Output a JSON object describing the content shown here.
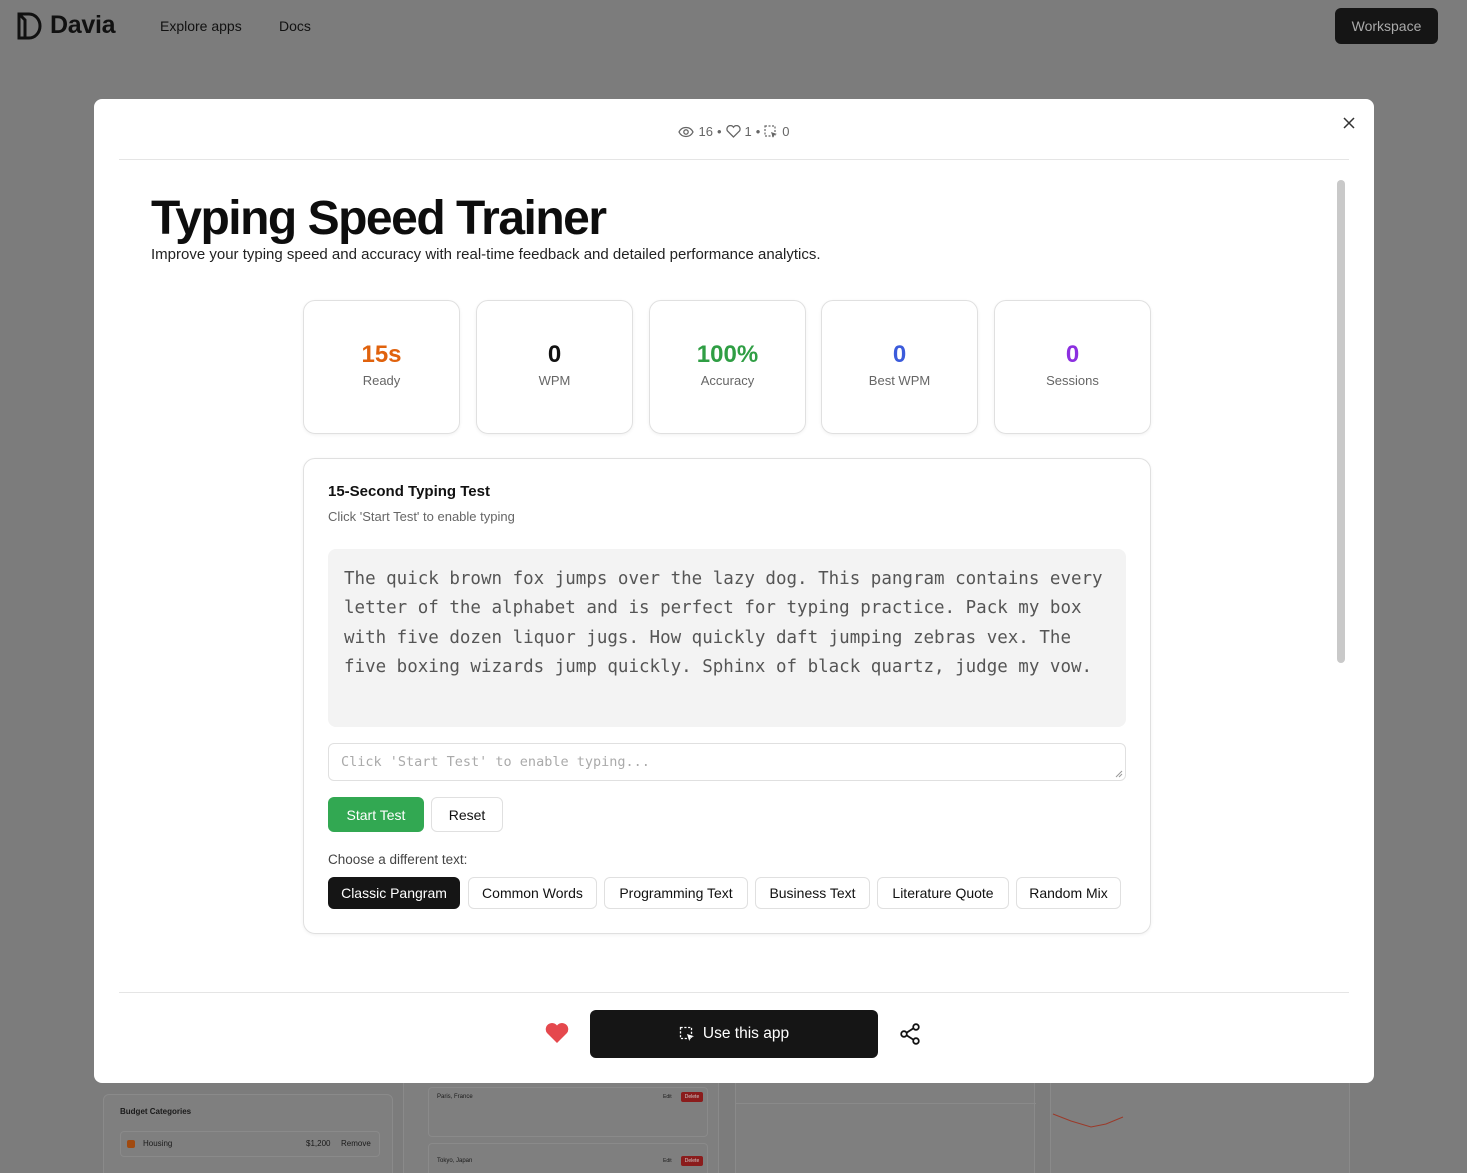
{
  "topnav": {
    "brand": "Davia",
    "links": [
      "Explore apps",
      "Docs"
    ],
    "workspace_label": "Workspace"
  },
  "background": {
    "budget_title": "Budget Categories",
    "budget_item": "Housing",
    "budget_amount": "$1,200",
    "budget_remove": "Remove",
    "trip1": "Paris, France",
    "trip2": "Tokyo, Japan",
    "edit_label": "Edit",
    "delete_label": "Delete"
  },
  "modal": {
    "views": "16",
    "likes": "1",
    "uses": "0",
    "sep": "•"
  },
  "app": {
    "title": "Typing Speed Trainer",
    "subtitle": "Improve your typing speed and accuracy with real-time feedback and detailed performance analytics.",
    "stats": [
      {
        "value": "15s",
        "label": "Ready",
        "color": "#e0620d"
      },
      {
        "value": "0",
        "label": "WPM",
        "color": "#111111"
      },
      {
        "value": "100%",
        "label": "Accuracy",
        "color": "#2f9e44"
      },
      {
        "value": "0",
        "label": "Best WPM",
        "color": "#3b5bdb"
      },
      {
        "value": "0",
        "label": "Sessions",
        "color": "#8c2fe0"
      }
    ],
    "test": {
      "title": "15-Second Typing Test",
      "subtitle": "Click 'Start Test' to enable typing",
      "passage": "The quick brown fox jumps over the lazy dog. This pangram contains every letter of the alphabet and is perfect for typing practice. Pack my box with five dozen liquor jugs. How quickly daft jumping zebras vex. The five boxing wizards jump quickly. Sphinx of black quartz, judge my vow.",
      "input_placeholder": "Click 'Start Test' to enable typing...",
      "start_label": "Start Test",
      "reset_label": "Reset",
      "choose_label": "Choose a different text:",
      "chips": [
        "Classic Pangram",
        "Common Words",
        "Programming Text",
        "Business Text",
        "Literature Quote",
        "Random Mix"
      ],
      "active_chip": "Classic Pangram"
    }
  },
  "footer": {
    "use_label": "Use this app"
  },
  "colors": {
    "accent_green": "#32a852",
    "heart": "#e5484d",
    "dark": "#151515"
  }
}
